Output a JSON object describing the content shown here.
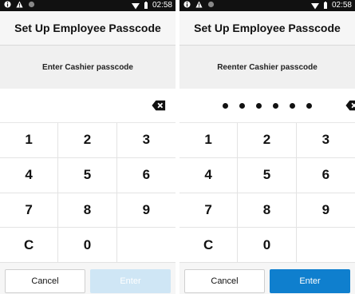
{
  "status_bar": {
    "time": "02:58",
    "icons": [
      "info-icon",
      "warning-icon",
      "record-icon",
      "wifi-icon",
      "battery-icon"
    ]
  },
  "screens": [
    {
      "title": "Set Up Employee Passcode",
      "prompt": "Enter Cashier passcode",
      "digits_entered": 0,
      "keys": [
        "1",
        "2",
        "3",
        "4",
        "5",
        "6",
        "7",
        "8",
        "9",
        "C",
        "0",
        ""
      ],
      "cancel_label": "Cancel",
      "enter_label": "Enter",
      "enter_enabled": false
    },
    {
      "title": "Set Up Employee Passcode",
      "prompt": "Reenter Cashier passcode",
      "digits_entered": 6,
      "keys": [
        "1",
        "2",
        "3",
        "4",
        "5",
        "6",
        "7",
        "8",
        "9",
        "C",
        "0",
        ""
      ],
      "cancel_label": "Cancel",
      "enter_label": "Enter",
      "enter_enabled": true
    }
  ],
  "colors": {
    "status_bar": "#111111",
    "accent_enter": "#0f7fce",
    "accent_enter_disabled": "#cfe6f5"
  }
}
